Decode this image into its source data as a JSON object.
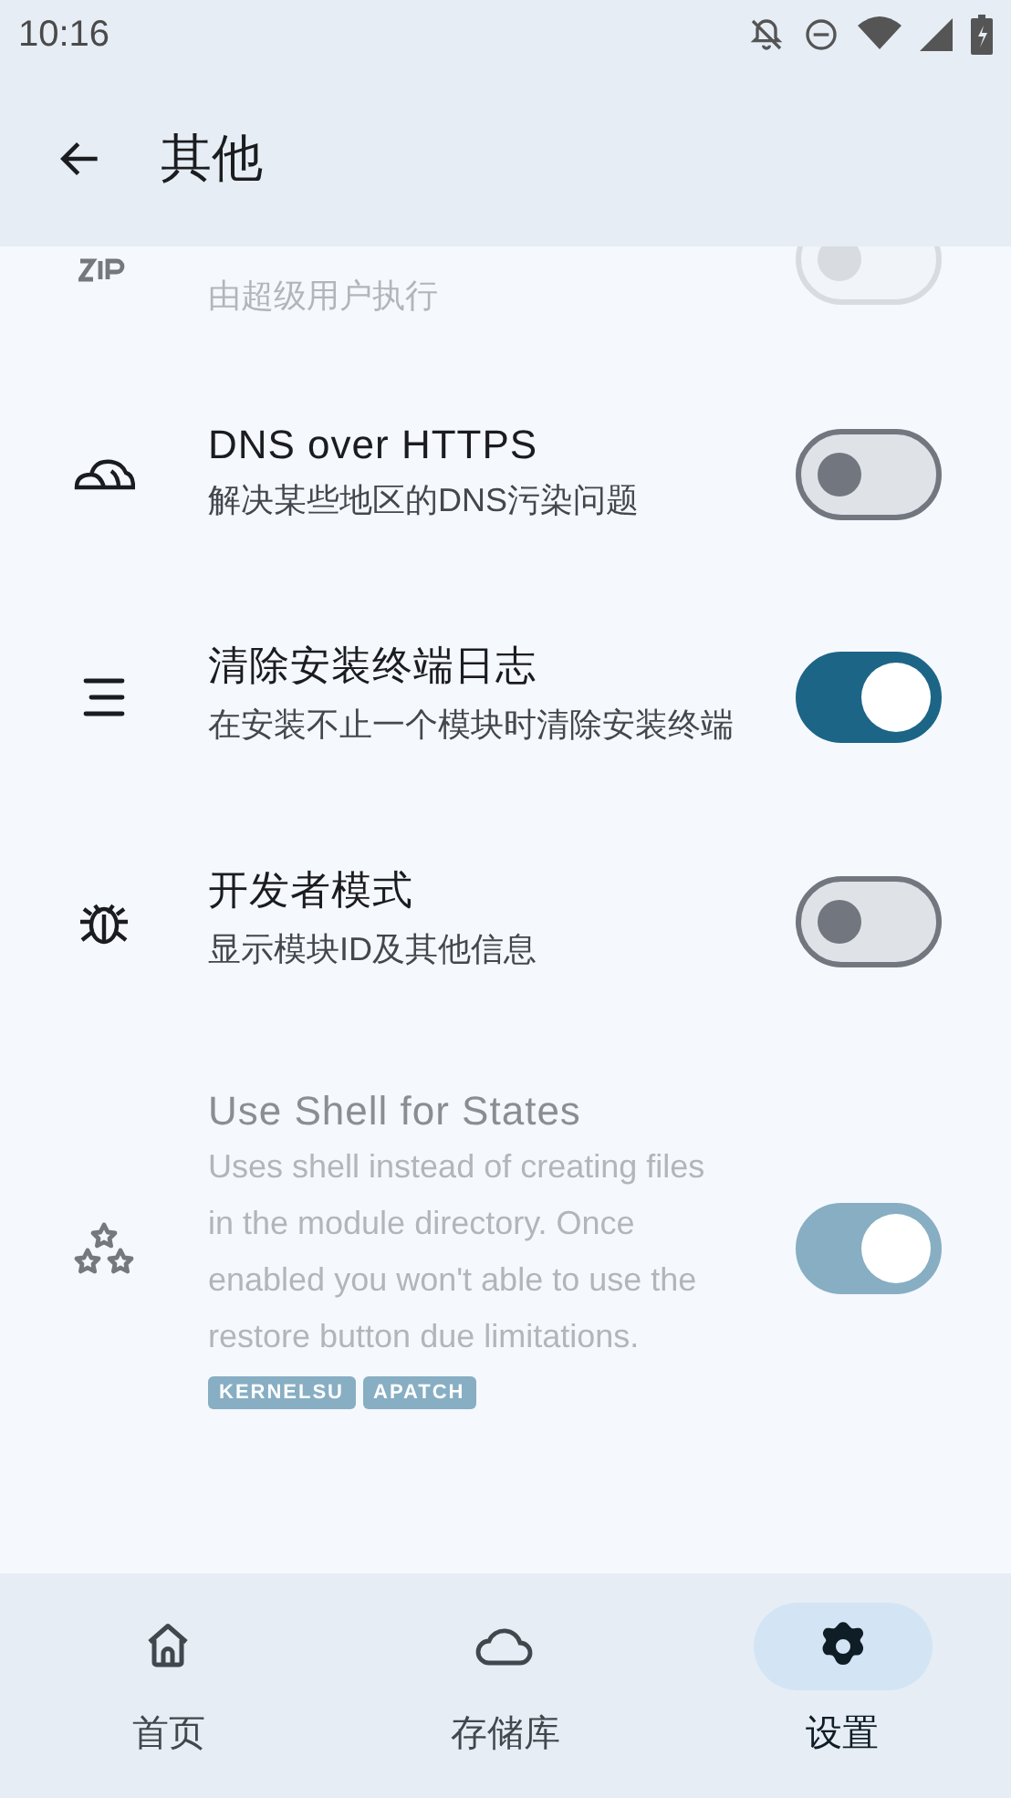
{
  "status_bar": {
    "time": "10:16"
  },
  "header": {
    "title": "其他"
  },
  "settings": [
    {
      "description": "由超级用户执行",
      "on": false,
      "disabled": true
    },
    {
      "title": "DNS over HTTPS",
      "description": "解决某些地区的DNS污染问题",
      "on": false,
      "disabled": false
    },
    {
      "title": "清除安装终端日志",
      "description": "在安装不止一个模块时清除安装终端",
      "on": true,
      "disabled": false
    },
    {
      "title": "开发者模式",
      "description": "显示模块ID及其他信息",
      "on": false,
      "disabled": false
    },
    {
      "title": "Use Shell for States",
      "description": "Uses shell instead of creating files in the module directory. Once enabled you won't able to use the restore button due limitations.",
      "on": true,
      "disabled": true,
      "tags": [
        "KERNELSU",
        "APATCH"
      ]
    }
  ],
  "nav": [
    {
      "label": "首页",
      "selected": false
    },
    {
      "label": "存储库",
      "selected": false
    },
    {
      "label": "设置",
      "selected": true
    }
  ]
}
